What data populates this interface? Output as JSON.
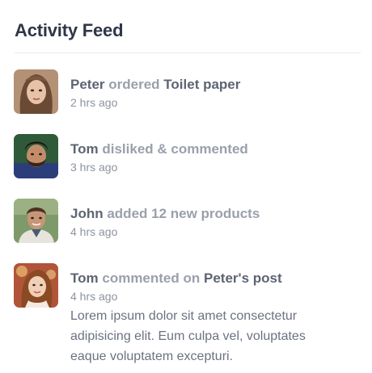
{
  "feed": {
    "title": "Activity Feed",
    "items": [
      {
        "actor": "Peter",
        "action": "ordered",
        "target": "Toilet paper",
        "time": "2 hrs ago",
        "avatar": "woman-avatar-1"
      },
      {
        "actor": "Tom",
        "action": "disliked & commented",
        "target": "",
        "time": "3 hrs ago",
        "avatar": "man-avatar-1"
      },
      {
        "actor": "John",
        "action": "added 12 new products",
        "target": "",
        "time": "4 hrs ago",
        "avatar": "man-avatar-2"
      },
      {
        "actor": "Tom",
        "action": "commented on",
        "target": "Peter's post",
        "time": "4 hrs ago",
        "avatar": "woman-avatar-2",
        "body": "Lorem ipsum dolor sit amet consectetur adipisicing elit. Eum culpa vel, voluptates eaque voluptatem excepturi."
      }
    ]
  },
  "colors": {
    "title": "#2f3646",
    "actor": "#5d6473",
    "muted": "#9aa0ab",
    "divider": "#e7e9ee"
  }
}
